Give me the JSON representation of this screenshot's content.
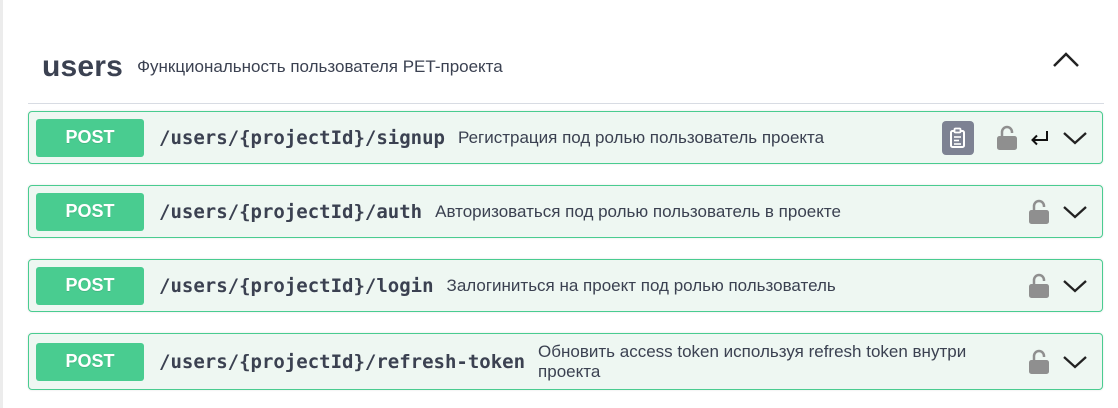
{
  "tag": {
    "name": "users",
    "description": "Функциональность пользователя PET-проекта"
  },
  "operations": [
    {
      "method": "POST",
      "path": "/users/{projectId}/signup",
      "summary": "Регистрация под ролью пользователь проекта"
    },
    {
      "method": "POST",
      "path": "/users/{projectId}/auth",
      "summary": "Авторизоваться под ролью пользователь в проекте"
    },
    {
      "method": "POST",
      "path": "/users/{projectId}/login",
      "summary": "Залогиниться на проект под ролью пользователь"
    },
    {
      "method": "POST",
      "path": "/users/{projectId}/refresh-token",
      "summary": "Обновить access token используя refresh token внутри проекта"
    }
  ],
  "colors": {
    "post": "#49cc90",
    "post_bg": "#eef7f2",
    "text": "#3b4151",
    "icon": "#7d8293"
  },
  "icons": {
    "collapse": "chevron-up-icon",
    "copy": "clipboard-copy-icon",
    "lock": "lock-open-icon",
    "enter": "enter-return-icon",
    "expand": "chevron-down-icon"
  }
}
